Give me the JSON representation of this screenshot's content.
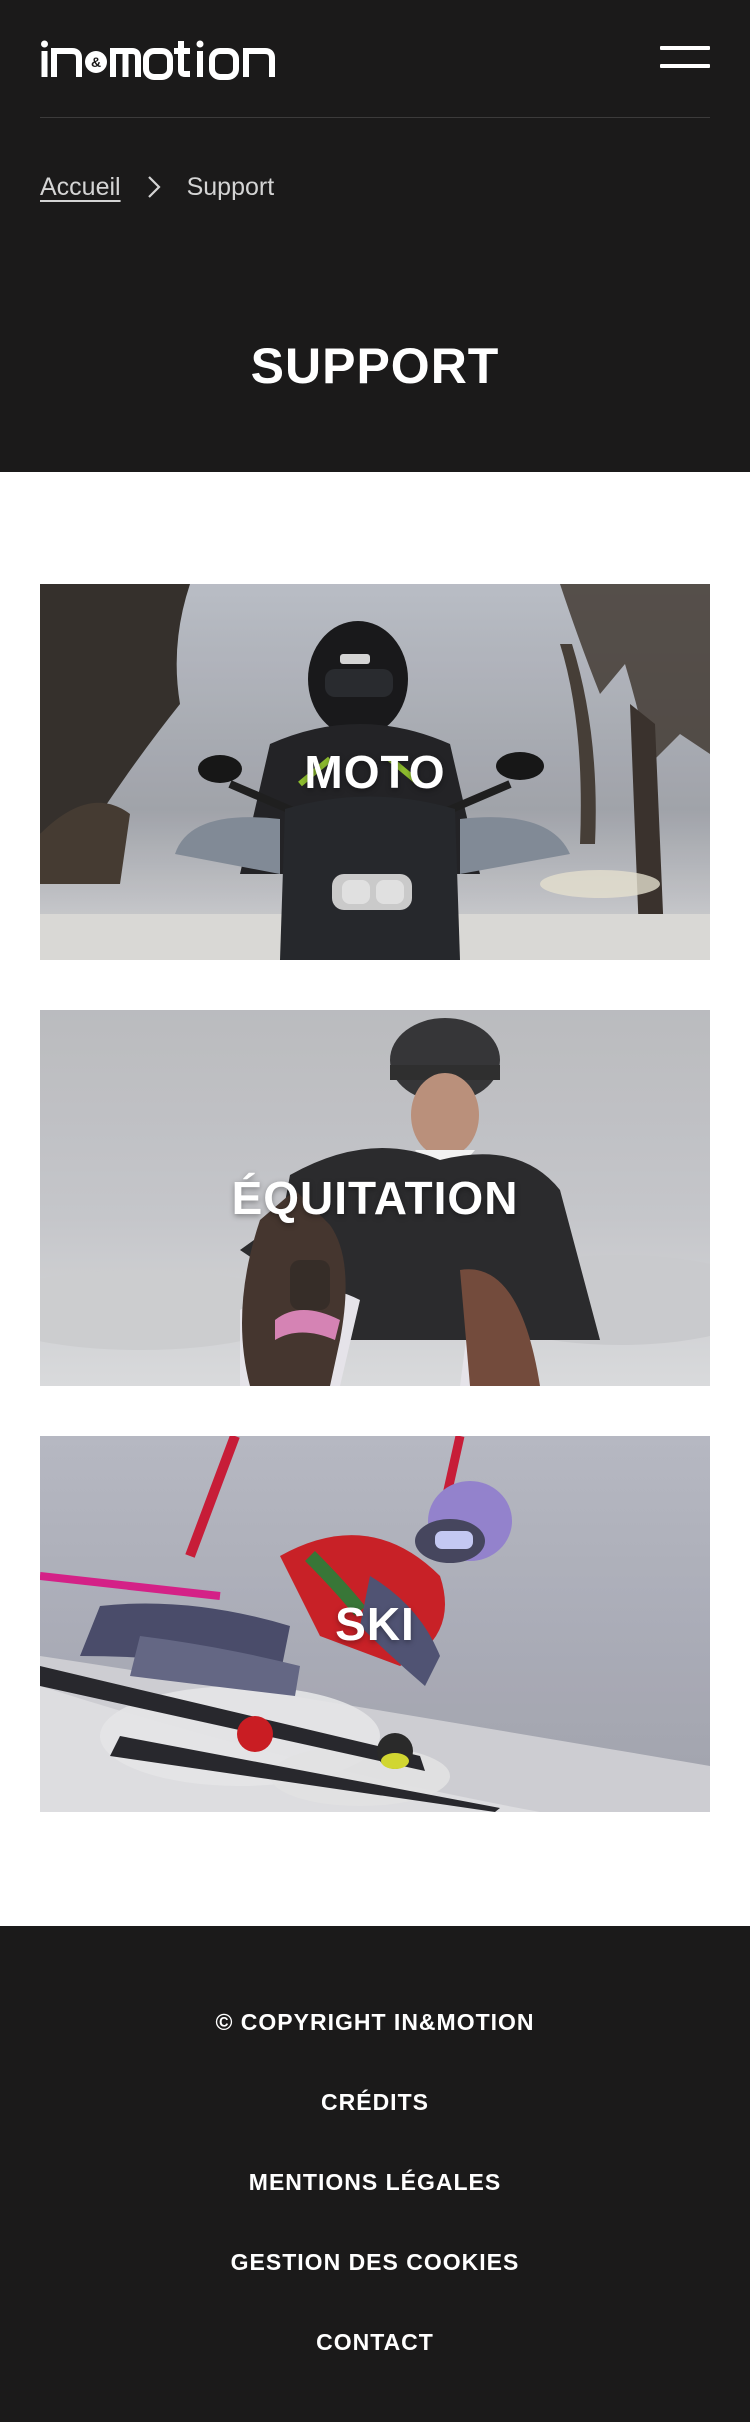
{
  "header": {
    "logo_text": "in&motion",
    "logo_alt": "in&motion logo"
  },
  "breadcrumb": {
    "home": "Accueil",
    "separator_icon": "chevron-right-icon",
    "current": "Support"
  },
  "page": {
    "title": "SUPPORT"
  },
  "cards": [
    {
      "label": "MOTO"
    },
    {
      "label": "ÉQUITATION"
    },
    {
      "label": "SKI"
    }
  ],
  "footer": {
    "links": [
      "© COPYRIGHT IN&MOTION",
      "CRÉDITS",
      "MENTIONS LÉGALES",
      "GESTION DES COOKIES",
      "CONTACT"
    ]
  },
  "colors": {
    "dark_background": "#1b1a1a",
    "text_light": "#ffffff",
    "breadcrumb_text": "#d4d4d4"
  }
}
